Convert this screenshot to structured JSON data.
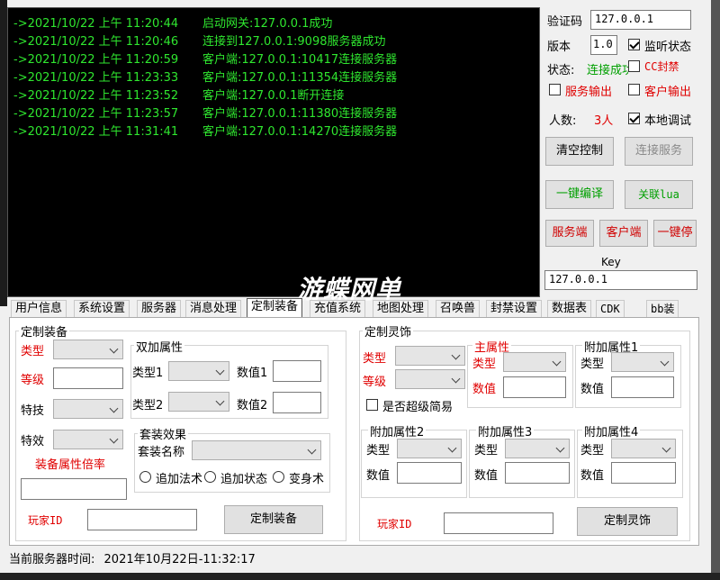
{
  "console": {
    "lines": [
      {
        "time": "->2021/10/22 上午 11:20:44",
        "msg": "启动网关:127.0.0.1成功"
      },
      {
        "time": "->2021/10/22 上午 11:20:46",
        "msg": "连接到127.0.0.1:9098服务器成功"
      },
      {
        "time": "->2021/10/22 上午 11:20:59",
        "msg": "客户端:127.0.0.1:10417连接服务器"
      },
      {
        "time": "->2021/10/22 上午 11:23:33",
        "msg": "客户端:127.0.0.1:11354连接服务器"
      },
      {
        "time": "->2021/10/22 上午 11:23:52",
        "msg": "客户端:127.0.0.1断开连接"
      },
      {
        "time": "->2021/10/22 上午 11:23:57",
        "msg": "客户端:127.0.0.1:11380连接服务器"
      },
      {
        "time": "->2021/10/22 上午 11:31:41",
        "msg": "客户端:127.0.0.1:14270连接服务器"
      }
    ]
  },
  "right_panel": {
    "verify_label": "验证码",
    "verify_value": "127.0.0.1",
    "version_label": "版本",
    "version_value": "1.0",
    "listen_label": "监听状态",
    "status_label": "状态:",
    "status_value": "连接成功",
    "cc_label": "CC封禁",
    "service_output_label": "服务输出",
    "client_output_label": "客户输出",
    "count_label": "人数:",
    "count_value": "3人",
    "local_debug_label": "本地调试",
    "clear_button": "清空控制",
    "connect_button": "连接服务",
    "compile_button": "一键编译",
    "lua_button": "关联lua",
    "server_button": "服务端",
    "client_button": "客户端",
    "stop_button": "一键停",
    "key_label": "Key",
    "key_value": "127.0.0.1"
  },
  "tabs": [
    "用户信息",
    "系统设置",
    "服务器",
    "消息处理",
    "定制装备",
    "充值系统",
    "地图处理",
    "召唤兽",
    "封禁设置",
    "数据表",
    "CDK",
    "bb装"
  ],
  "active_tab": "定制装备",
  "equip": {
    "group_title": "定制装备",
    "type_label": "类型",
    "level_label": "等级",
    "skill_label": "特技",
    "effect_label": "特效",
    "ratio_label": "装备属性倍率",
    "player_label": "玩家ID",
    "submit_button": "定制装备",
    "double_title": "双加属性",
    "type1_label": "类型1",
    "value1_label": "数值1",
    "type2_label": "类型2",
    "value2_label": "数值2",
    "set_title": "套装效果",
    "set_name_label": "套装名称",
    "radio1": "追加法术",
    "radio2": "追加状态",
    "radio3": "变身术"
  },
  "spirit": {
    "group_title": "定制灵饰",
    "type_label": "类型",
    "level_label": "等级",
    "super_label": "是否超级简易",
    "main_title": "主属性",
    "main_type": "类型",
    "main_value": "数值",
    "add1_title": "附加属性1",
    "add2_title": "附加属性2",
    "add3_title": "附加属性3",
    "add4_title": "附加属性4",
    "type": "类型",
    "value": "数值",
    "player_label": "玩家ID",
    "submit_button": "定制灵饰"
  },
  "status_bar": {
    "label": "当前服务器时间:",
    "value": "2021年10月22日-11:32:17"
  },
  "watermark": "游蝶网单"
}
